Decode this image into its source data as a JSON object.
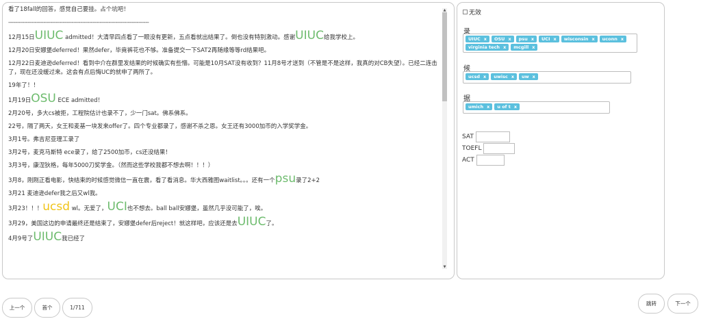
{
  "post": {
    "line1": "看了18fall的回答，感觉自己要挂。占个坑吧！",
    "separator": "--------------------------------------------------------------------------------",
    "p1_a": "12月15日",
    "p1_hl": "UIUC",
    "p1_b": " admitted！大清早四点看了一眼没有更新，五点看就出结果了。倒也没有特别激动。感谢",
    "p1_hl2": "UIUC",
    "p1_c": "给我学校上。",
    "p2": "12月20日安娜堡deferred！果然defer，毕竟裤花也不够。准备提交一下SAT2再随缘等等rd结果吧。",
    "p3": "12月22日麦迪逊deferred！看到中介在群里发结果的时候确实有些懵。可能是10月SAT没有收到？11月8号才送到（不管是不是这样，我真的对CB失望）。已经二连击了，现在还没缓过来。这会有点后悔UC的就申了两所了。",
    "p4": "19年了！！",
    "p5_a": "1月19日",
    "p5_hl": "OSU",
    "p5_b": " ECE admitted！",
    "p6": "2月20号，多大cs被拒，工程院估计也录不了，少一门sat。佛系佛系。",
    "p7": "22号，隔了两天，女王和麦基一块发来offer了。四个专业都录了，感谢不杀之恩。女王还有3000加币的入学奖学金。",
    "p8": "3月1号。弗吉尼亚理工录了",
    "p9": "3月2号，麦克马斯特 ece录了，给了2500加币，cs还没结果！",
    "p10": "3月3号，康涅狄格，每年5000刀奖学金。（然而这些学校我都不想去啊！！！）",
    "p11_a": "3月8，刚刚正看电影，快结束的时候感觉微信一直在震，看了看消息。华大西雅图waitlist。。。还有一个",
    "p11_hl": "psu",
    "p11_b": "录了2+2",
    "p12": "3月21 麦迪逊defer我之后又wl我。",
    "p13_a": "3月23！！！",
    "p13_hl": "ucsd",
    "p13_b": " wl。无爱了，",
    "p13_hl2": "UCI",
    "p13_c": "也不想去。ball ball安娜堡，虽然几乎没可能了，唉。",
    "p14_a": "3月29，美国这边的申请最终还是结束了，安娜堡defer后reject！就这样吧，应该还是去",
    "p14_hl": "UIUC",
    "p14_b": "了。",
    "p15_a": "4月9号了",
    "p15_hl": "UIUC",
    "p15_b": "我已经了"
  },
  "sidebar": {
    "invalid_label": "无效",
    "admit_label": "录",
    "admit_tags": [
      "UIUC",
      "OSU",
      "psu",
      "UCI",
      "wisconsin",
      "uconn",
      "virginia tech",
      "mcgill"
    ],
    "waitlist_label": "候",
    "waitlist_tags": [
      "ucsd",
      "uwisc",
      "uw"
    ],
    "reject_label": "据",
    "reject_tags": [
      "umich",
      "u of t"
    ],
    "tag_remove": "x",
    "sat_label": "SAT",
    "toefl_label": "TOEFL",
    "act_label": "ACT"
  },
  "pager": {
    "prev": "上一个",
    "first": "首个",
    "page": "1/711",
    "jump": "跳转",
    "next": "下一个"
  },
  "colors": {
    "tag": "#5bc0de",
    "highlight_green": "#6dbb6d",
    "highlight_yellow": "#f0c419"
  }
}
